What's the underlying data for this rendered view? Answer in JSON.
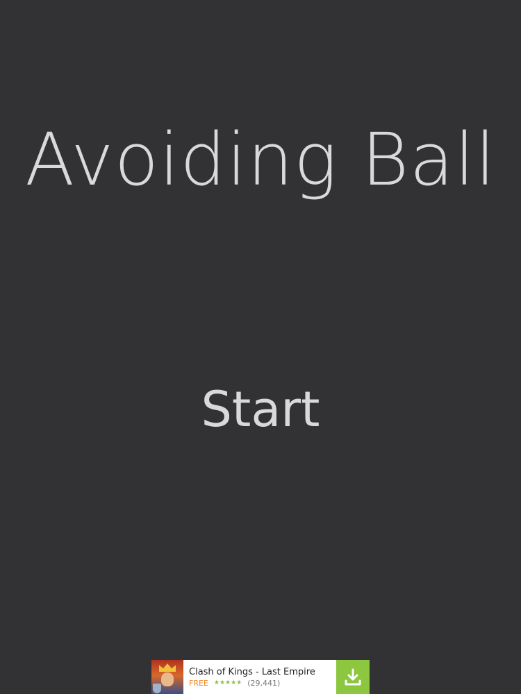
{
  "game": {
    "title": "Avoiding Ball",
    "start_label": "Start"
  },
  "ad": {
    "app_name": "Clash of Kings - Last Empire",
    "price": "FREE",
    "stars": "★★★★★",
    "rating_count": "(29,441)",
    "icon": "game-icon",
    "download_icon": "download-icon",
    "accent_color": "#8dc63f"
  },
  "colors": {
    "background": "#323133",
    "text": "#d9d9d9",
    "price": "#f08a24"
  }
}
